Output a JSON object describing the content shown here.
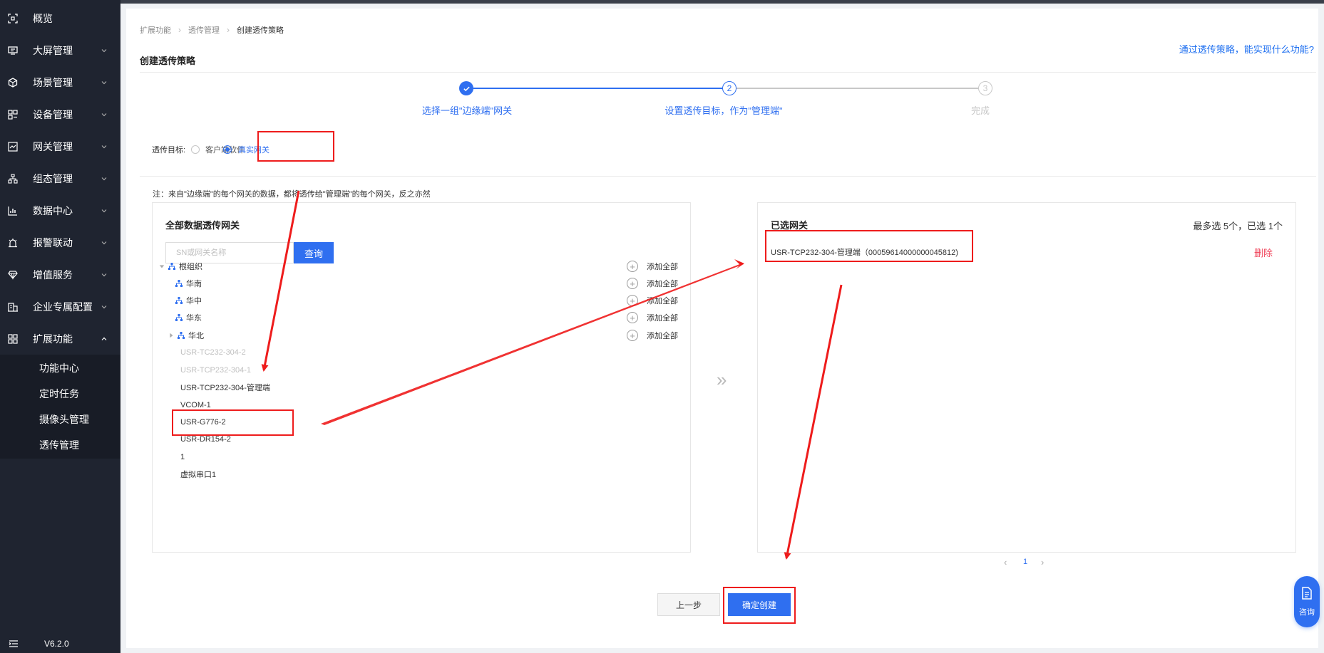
{
  "sidebar": {
    "items": [
      {
        "label": "概览",
        "icon": "overview-icon",
        "expandable": false
      },
      {
        "label": "大屏管理",
        "icon": "screen-icon",
        "expandable": true
      },
      {
        "label": "场景管理",
        "icon": "scene-icon",
        "expandable": true
      },
      {
        "label": "设备管理",
        "icon": "device-icon",
        "expandable": true
      },
      {
        "label": "网关管理",
        "icon": "gateway-icon",
        "expandable": true
      },
      {
        "label": "组态管理",
        "icon": "topology-icon",
        "expandable": true
      },
      {
        "label": "数据中心",
        "icon": "data-chart-icon",
        "expandable": true
      },
      {
        "label": "报警联动",
        "icon": "alarm-icon",
        "expandable": true
      },
      {
        "label": "增值服务",
        "icon": "diamond-icon",
        "expandable": true
      },
      {
        "label": "企业专属配置",
        "icon": "enterprise-icon",
        "expandable": true
      },
      {
        "label": "扩展功能",
        "icon": "apps-icon",
        "expandable": true,
        "expanded": true
      }
    ],
    "submenu": [
      "功能中心",
      "定时任务",
      "摄像头管理",
      "透传管理"
    ],
    "version": "V6.2.0"
  },
  "breadcrumb": [
    "扩展功能",
    "透传管理",
    "创建透传策略"
  ],
  "page_title": "创建透传策略",
  "help_link": "通过透传策略，能实现什么功能?",
  "steps": [
    {
      "label": "选择一组\"边缘端\"网关",
      "state": "done"
    },
    {
      "index": "2",
      "label": "设置透传目标，作为\"管理端\"",
      "state": "active"
    },
    {
      "index": "3",
      "label": "完成",
      "state": "pending"
    }
  ],
  "target": {
    "label": "透传目标:",
    "options": [
      "客户端软件",
      "真实网关"
    ],
    "selected": "真实网关"
  },
  "note": "注：来自\"边缘端\"的每个网关的数据，都将透传给\"管理端\"的每个网关，反之亦然",
  "left_panel": {
    "title": "全部数据透传网关",
    "search_placeholder": "SN或网关名称",
    "search_button": "查询",
    "add_all_label": "添加全部",
    "root": "根组织",
    "groups": [
      "华南",
      "华中",
      "华东",
      "华北"
    ],
    "gateways": [
      {
        "name": "USR-TC232-304-2",
        "disabled": true
      },
      {
        "name": "USR-TCP232-304-1",
        "disabled": true
      },
      {
        "name": "USR-TCP232-304-管理端",
        "disabled": false
      },
      {
        "name": "VCOM-1",
        "disabled": false
      },
      {
        "name": "USR-G776-2",
        "disabled": false
      },
      {
        "name": "USR-DR154-2",
        "disabled": false
      },
      {
        "name": "1",
        "disabled": false
      },
      {
        "name": "虚拟串口1",
        "disabled": false
      }
    ]
  },
  "transfer_icon": "»",
  "right_panel": {
    "title": "已选网关",
    "quota": "最多选 5个，已选 1个",
    "selected": [
      {
        "text": "USR-TCP232-304-管理端（00059614000000045812)",
        "action": "删除"
      }
    ]
  },
  "pagination": {
    "prev": "‹",
    "page": "1",
    "next": "›"
  },
  "buttons": {
    "prev": "上一步",
    "create": "确定创建"
  },
  "consult": "咨询",
  "colors": {
    "primary": "#2f6ff0",
    "sidebar": "#1f2430",
    "danger": "#f0445b",
    "annotation": "#ee1c1c"
  }
}
